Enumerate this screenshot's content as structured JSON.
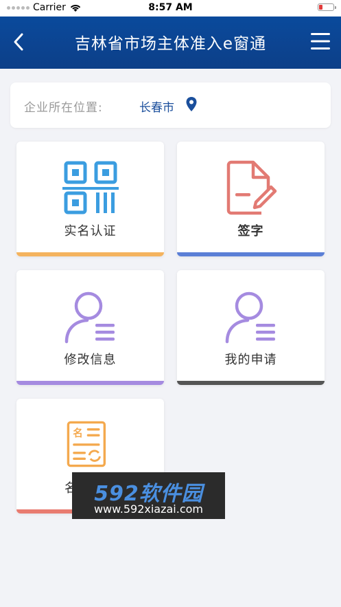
{
  "status_bar": {
    "carrier": "Carrier",
    "time": "8:57 AM"
  },
  "nav": {
    "title": "吉林省市场主体准入e窗通",
    "back_icon": "chevron-left-icon",
    "menu_icon": "hamburger-menu-icon"
  },
  "location": {
    "label": "企业所在位置:",
    "city": "长春市",
    "icon": "map-pin-icon"
  },
  "tiles": [
    {
      "label": "实名认证",
      "icon": "qr-code-icon",
      "color": "#f4b35e"
    },
    {
      "label": "签字",
      "icon": "sign-document-icon",
      "color": "#5b7fd6"
    },
    {
      "label": "修改信息",
      "icon": "user-edit-icon",
      "color": "#a58be0"
    },
    {
      "label": "我的申请",
      "icon": "user-application-icon",
      "color": "#555555"
    },
    {
      "label": "名",
      "icon": "name-refresh-icon",
      "color": "#e97b70"
    }
  ],
  "watermark": {
    "brand": "592软件园",
    "url": "www.592xiazai.com"
  },
  "colors": {
    "nav": "#0d4a9a",
    "accent_blue": "#3b9de0",
    "accent_red": "#e27a73",
    "accent_purple": "#a58be0",
    "accent_orange": "#f4a94e"
  }
}
